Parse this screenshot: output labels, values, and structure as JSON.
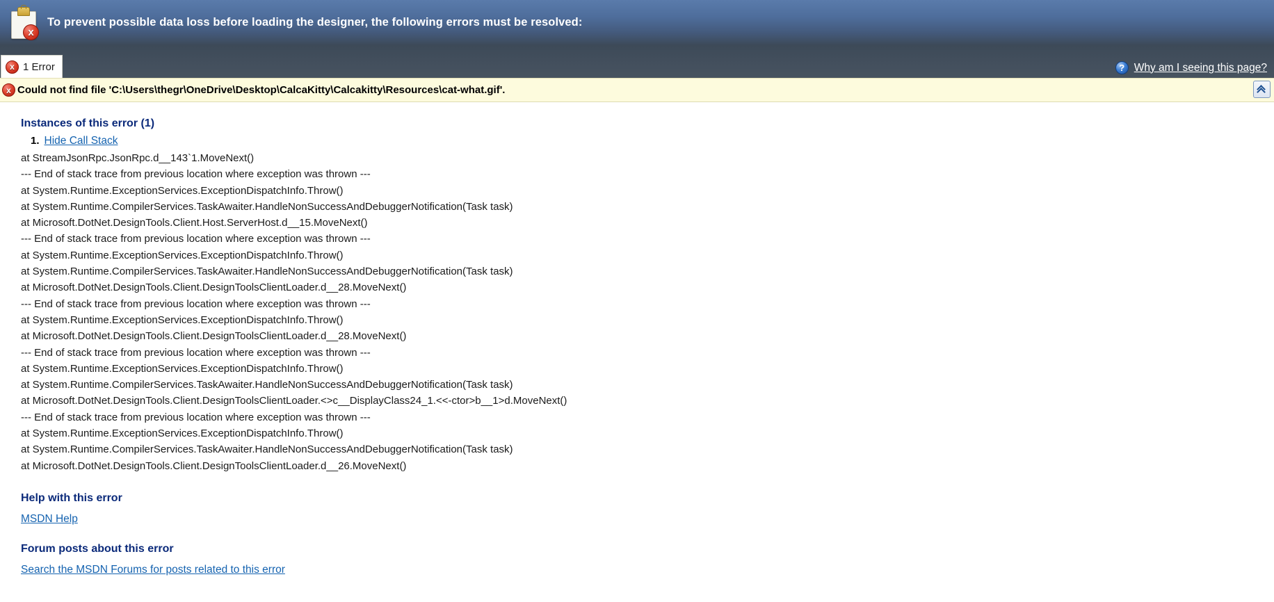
{
  "banner": {
    "icon": "clipboard-error-icon",
    "message": "To prevent possible data loss before loading the designer, the following errors must be resolved:"
  },
  "tabstrip": {
    "tab": {
      "icon": "error-icon",
      "label": "1 Error"
    },
    "help_link": {
      "icon": "help-question-icon",
      "label": "Why am I seeing this page?"
    }
  },
  "errorbar": {
    "icon": "error-icon",
    "message": "Could not find file 'C:\\Users\\thegr\\OneDrive\\Desktop\\CalcaKitty\\Calcakitty\\Resources\\cat-what.gif'.",
    "collapse_button": "collapse-chevron-up-icon"
  },
  "instances": {
    "heading": "Instances of this error (1)",
    "number": "1.",
    "toggle_link": "Hide Call Stack",
    "call_stack": [
      "at StreamJsonRpc.JsonRpc.d__143`1.MoveNext()",
      "--- End of stack trace from previous location where exception was thrown ---",
      "at System.Runtime.ExceptionServices.ExceptionDispatchInfo.Throw()",
      "at System.Runtime.CompilerServices.TaskAwaiter.HandleNonSuccessAndDebuggerNotification(Task task)",
      "at Microsoft.DotNet.DesignTools.Client.Host.ServerHost.d__15.MoveNext()",
      "--- End of stack trace from previous location where exception was thrown ---",
      "at System.Runtime.ExceptionServices.ExceptionDispatchInfo.Throw()",
      "at System.Runtime.CompilerServices.TaskAwaiter.HandleNonSuccessAndDebuggerNotification(Task task)",
      "at Microsoft.DotNet.DesignTools.Client.DesignToolsClientLoader.d__28.MoveNext()",
      "--- End of stack trace from previous location where exception was thrown ---",
      "at System.Runtime.ExceptionServices.ExceptionDispatchInfo.Throw()",
      "at Microsoft.DotNet.DesignTools.Client.DesignToolsClientLoader.d__28.MoveNext()",
      "--- End of stack trace from previous location where exception was thrown ---",
      "at System.Runtime.ExceptionServices.ExceptionDispatchInfo.Throw()",
      "at System.Runtime.CompilerServices.TaskAwaiter.HandleNonSuccessAndDebuggerNotification(Task task)",
      "at Microsoft.DotNet.DesignTools.Client.DesignToolsClientLoader.<>c__DisplayClass24_1.<<-ctor>b__1>d.MoveNext()",
      "--- End of stack trace from previous location where exception was thrown ---",
      "at System.Runtime.ExceptionServices.ExceptionDispatchInfo.Throw()",
      "at System.Runtime.CompilerServices.TaskAwaiter.HandleNonSuccessAndDebuggerNotification(Task task)",
      "at Microsoft.DotNet.DesignTools.Client.DesignToolsClientLoader.d__26.MoveNext()"
    ]
  },
  "help_section": {
    "heading": "Help with this error",
    "link": "MSDN Help"
  },
  "forum_section": {
    "heading": "Forum posts about this error",
    "link": "Search the MSDN Forums for posts related to this error"
  },
  "colors": {
    "banner_top": "#5a7bab",
    "banner_bottom": "#3d4a58",
    "error_bar_bg": "#fdfbdd",
    "heading_blue": "#0b2a7a",
    "link_blue": "#1563b0",
    "error_red": "#d03a22"
  },
  "glyphs": {
    "error_x": "x",
    "help_q": "?"
  }
}
